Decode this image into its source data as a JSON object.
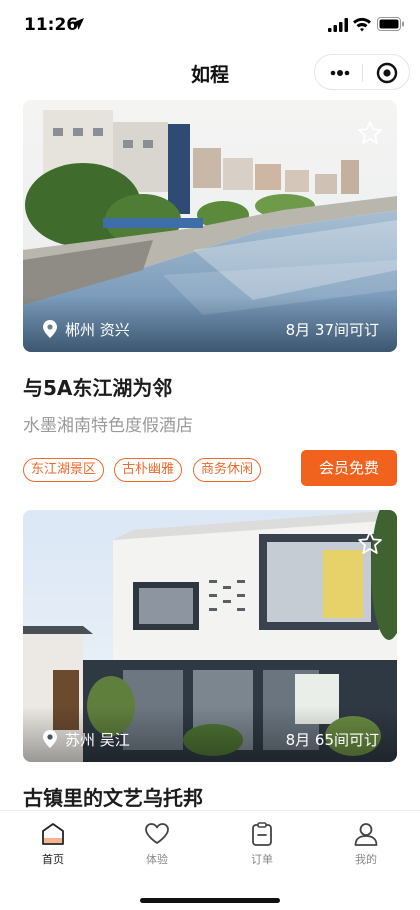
{
  "status_bar": {
    "time": "11:26"
  },
  "nav": {
    "title": "如程"
  },
  "cards": [
    {
      "location": "郴州 资兴",
      "availability": "8月 37间可订",
      "title": "与5A东江湖为邻",
      "subtitle": "水墨湘南特色度假酒店",
      "tags": [
        "东江湖景区",
        "古朴幽雅",
        "商务休闲"
      ],
      "button_label": "会员免费"
    },
    {
      "location": "苏州 吴江",
      "availability": "8月 65间可订",
      "title": "古镇里的文艺乌托邦"
    }
  ],
  "tabs": [
    {
      "label": "首页",
      "icon": "home-icon",
      "active": true
    },
    {
      "label": "体验",
      "icon": "heart-icon",
      "active": false
    },
    {
      "label": "订单",
      "icon": "clipboard-icon",
      "active": false
    },
    {
      "label": "我的",
      "icon": "user-icon",
      "active": false
    }
  ],
  "colors": {
    "accent": "#f2621f",
    "tag": "#f06a2b"
  }
}
